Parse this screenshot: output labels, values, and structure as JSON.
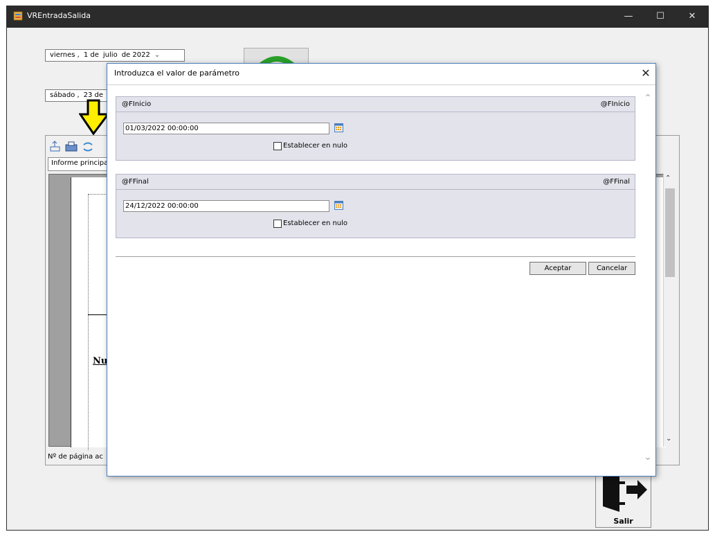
{
  "window": {
    "title": "VREntradaSalida",
    "minimize": "—",
    "maximize": "☐",
    "close": "✕"
  },
  "date_from": {
    "weekday": "viernes ,",
    "day": "1 de",
    "month": "julio",
    "year": "de 2022"
  },
  "date_to": {
    "weekday": "sábado ,",
    "day": "23 de",
    "month": "",
    "year": ""
  },
  "viewer": {
    "tab_label": "Informe principal",
    "status_label": "Nº de página ac",
    "paper_text": "Nu"
  },
  "dialog": {
    "title": "Introduzca el valor de parámetro",
    "close": "✕",
    "params": [
      {
        "name": "@FInicio",
        "name_right": "@FInicio",
        "value": "01/03/2022 00:00:00",
        "null_label": "Establecer en nulo"
      },
      {
        "name": "@FFinal",
        "name_right": "@FFinal",
        "value": "24/12/2022 00:00:00",
        "null_label": "Establecer en nulo"
      }
    ],
    "accept_label": "Aceptar",
    "cancel_label": "Cancelar"
  },
  "exit_button": {
    "label": "Salir"
  },
  "colors": {
    "titlebar": "#2b2b2b",
    "panel": "#e3e3ec",
    "arrow": "#ffee00",
    "refresh_green": "#2aa02a"
  },
  "icons": [
    "app-icon",
    "export-icon",
    "print-icon",
    "refresh-icon",
    "calendar-icon",
    "exit-door-icon",
    "down-arrow-indicator-icon"
  ]
}
